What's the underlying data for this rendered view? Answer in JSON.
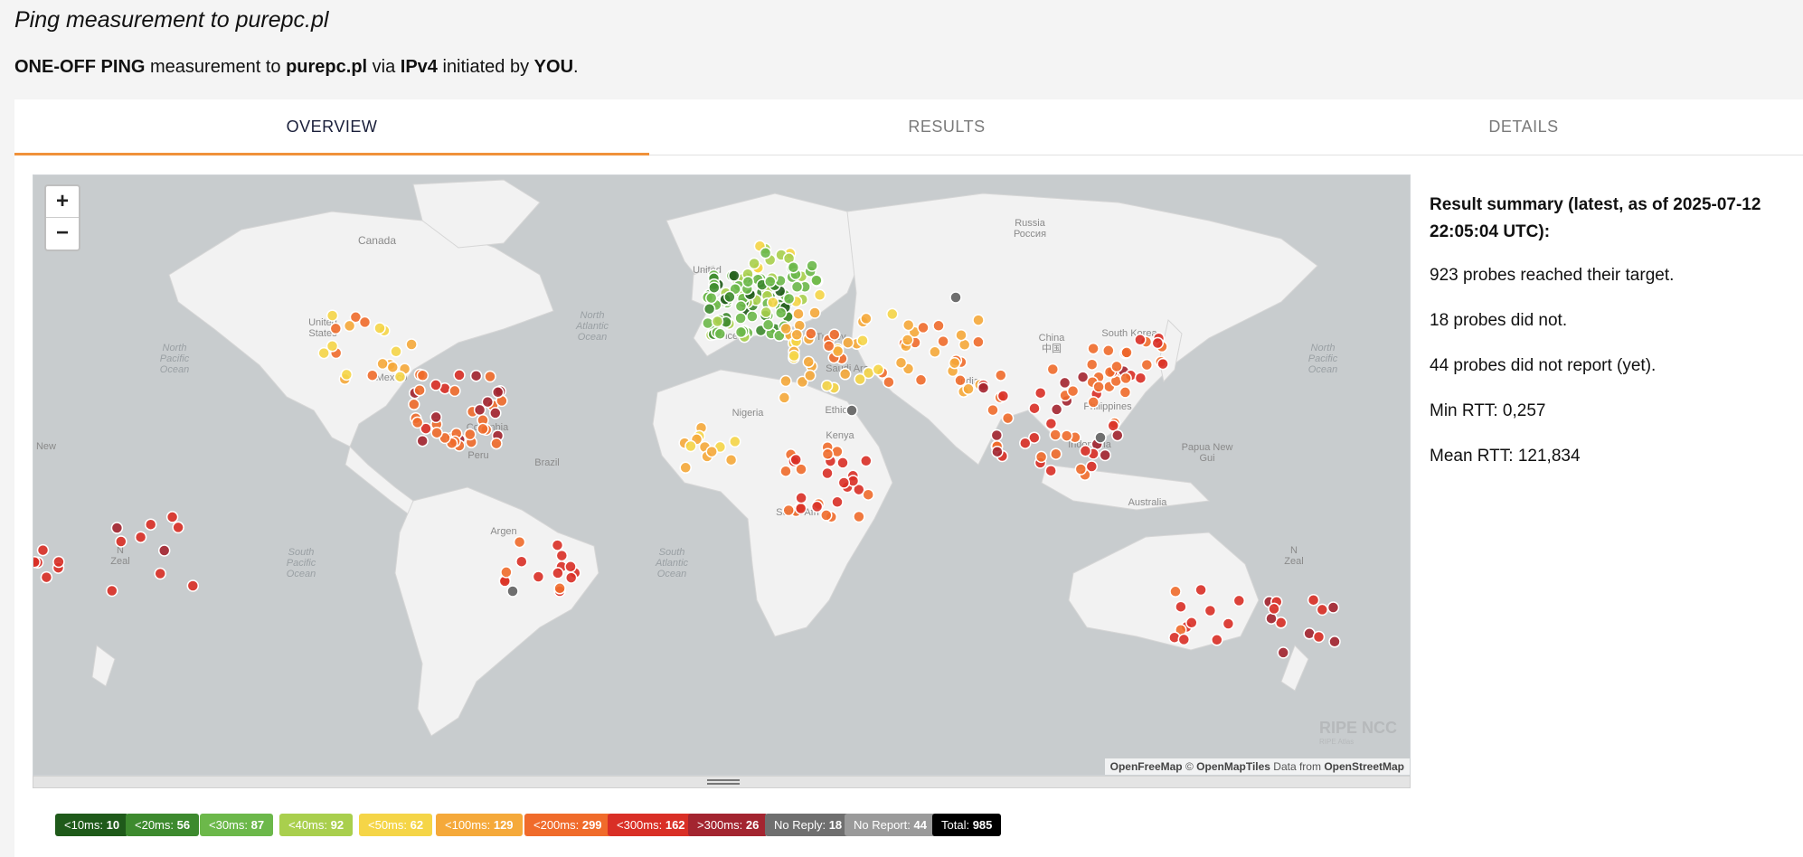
{
  "page": {
    "title": "Ping measurement to purepc.pl",
    "subtitle": {
      "type": "ONE-OFF PING",
      "t1": " measurement to ",
      "target": "purepc.pl",
      "t2": " via ",
      "af": "IPv4",
      "t3": " initiated by ",
      "initiator": "YOU",
      "t4": "."
    }
  },
  "tabs": [
    "OVERVIEW",
    "RESULTS",
    "DETAILS"
  ],
  "map": {
    "zoom_in": "+",
    "zoom_out": "−",
    "labels": {
      "canada": "Canada",
      "united_states": "United\nStates",
      "north_pacific_w": "North\nPacific\nOcean",
      "north_pacific_e": "North\nPacific\nOcean",
      "north_atlantic": "North\nAtlantic\nOcean",
      "russia": "Russia\nРоссия",
      "china": "China\n中国",
      "india": "India",
      "brazil": "Brazil",
      "peru": "Peru",
      "australia": "Australia",
      "south_pacific": "South\nPacific\nOcean",
      "south_atlantic": "South\nAtlantic\nOcean",
      "saudi": "Saudi Ara",
      "kenya": "Kenya",
      "indonesia": "Indonesia",
      "philippines": "Philippines",
      "papua": "Papua New\nGui",
      "new_zealand_w": "N\nZeal",
      "new_zealand_e": "N\nZeal",
      "south_africa": "South Afri",
      "colombia": "Colombia",
      "mexico": "Mexico",
      "france": "France",
      "turkey": "Turkey",
      "ethiopia": "Ethio",
      "nigeria": "Nigeria",
      "argentina": "Argen",
      "south_korea": "South Korea",
      "united_kingdom": "United",
      "new_w": "New"
    },
    "attribution": {
      "a": "OpenFreeMap",
      "b": " © ",
      "c": "OpenMapTiles",
      "d": " Data from ",
      "e": "OpenStreetMap"
    },
    "logo": "RIPE NCC",
    "logo_sub": "RIPE Atlas"
  },
  "summary": {
    "heading": "Result summary (latest, as of 2025-07-12 22:05:04 UTC):",
    "reached": "923 probes reached their target.",
    "did_not": "18 probes did not.",
    "no_report": "44 probes did not report (yet).",
    "min_rtt": "Min RTT: 0,257",
    "mean_rtt": "Mean RTT: 121,834"
  },
  "legend": [
    {
      "label": "<10ms:",
      "count": "10",
      "color": "#1f5a1a",
      "icon": "lt10"
    },
    {
      "label": "<20ms:",
      "count": "56",
      "color": "#3d8a2e",
      "icon": "lt20"
    },
    {
      "label": "<30ms:",
      "count": "87",
      "color": "#6cb84a",
      "icon": "lt30"
    },
    {
      "label": "<40ms:",
      "count": "92",
      "color": "#a9cf4d",
      "icon": "lt40"
    },
    {
      "label": "<50ms:",
      "count": "62",
      "color": "#f5d547",
      "icon": "lt50"
    },
    {
      "label": "<100ms:",
      "count": "129",
      "color": "#f5a93a",
      "icon": "lt100"
    },
    {
      "label": "<200ms:",
      "count": "299",
      "color": "#f06b2b",
      "icon": "lt200"
    },
    {
      "label": "<300ms:",
      "count": "162",
      "color": "#d92f26",
      "icon": "lt300"
    },
    {
      "label": ">300ms:",
      "count": "26",
      "color": "#a32530",
      "icon": "gt300"
    },
    {
      "label": "No Reply:",
      "count": "18",
      "color": "#6f6f6f",
      "icon": "noreply"
    },
    {
      "label": "No Report:",
      "count": "44",
      "color": "#9a9a9a",
      "icon": "noreport"
    },
    {
      "label": "Total:",
      "count": "985",
      "color": "#000000",
      "icon": "total"
    }
  ],
  "colors": {
    "water": "#c8ccce",
    "land": "#f2f2f2",
    "accent": "#f0913a"
  }
}
